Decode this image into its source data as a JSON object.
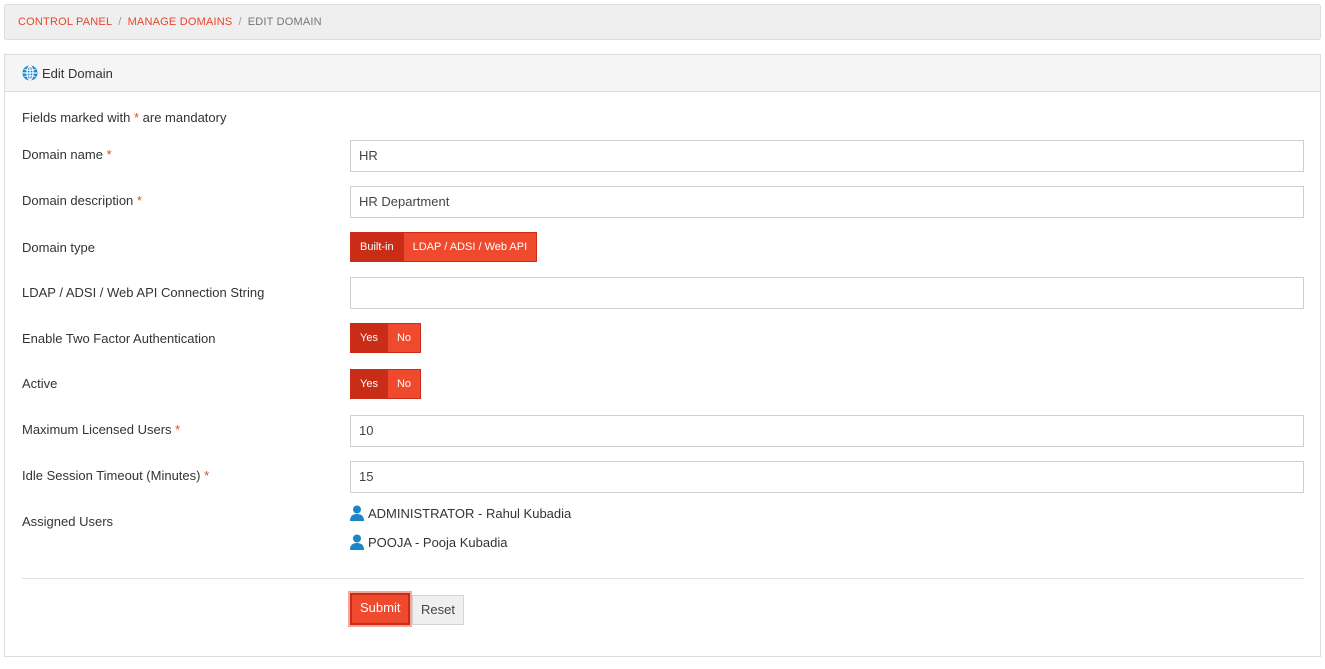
{
  "breadcrumb": {
    "item1": "CONTROL PANEL",
    "item2": "MANAGE DOMAINS",
    "item3": "EDIT DOMAIN",
    "separator": "/"
  },
  "panel": {
    "title": "Edit Domain",
    "icon": "globe-icon"
  },
  "form": {
    "note_prefix": "Fields marked with ",
    "note_star": "*",
    "note_suffix": " are mandatory",
    "domain_name": {
      "label": "Domain name",
      "value": "HR",
      "required": "*"
    },
    "domain_description": {
      "label": "Domain description",
      "value": "HR Department",
      "required": "*"
    },
    "domain_type": {
      "label": "Domain type",
      "options": [
        "Built-in",
        "LDAP / ADSI / Web API"
      ],
      "selected": "Built-in"
    },
    "connection_string": {
      "label": "LDAP / ADSI / Web API Connection String",
      "value": ""
    },
    "two_factor": {
      "label": "Enable Two Factor Authentication",
      "yes": "Yes",
      "no": "No",
      "selected": "Yes"
    },
    "active": {
      "label": "Active",
      "yes": "Yes",
      "no": "No",
      "selected": "Yes"
    },
    "max_users": {
      "label": "Maximum Licensed Users",
      "value": "10",
      "required": "*"
    },
    "idle_timeout": {
      "label": "Idle Session Timeout (Minutes)",
      "value": "15",
      "required": "*"
    },
    "assigned_users": {
      "label": "Assigned Users",
      "users": [
        "ADMINISTRATOR - Rahul Kubadia",
        "POOJA - Pooja Kubadia"
      ]
    }
  },
  "actions": {
    "submit_label": "Submit",
    "reset_label": "Reset"
  },
  "colors": {
    "accent": "#ef4a2e",
    "accent_dark": "#c92d17",
    "icon_blue": "#1a86c8"
  }
}
